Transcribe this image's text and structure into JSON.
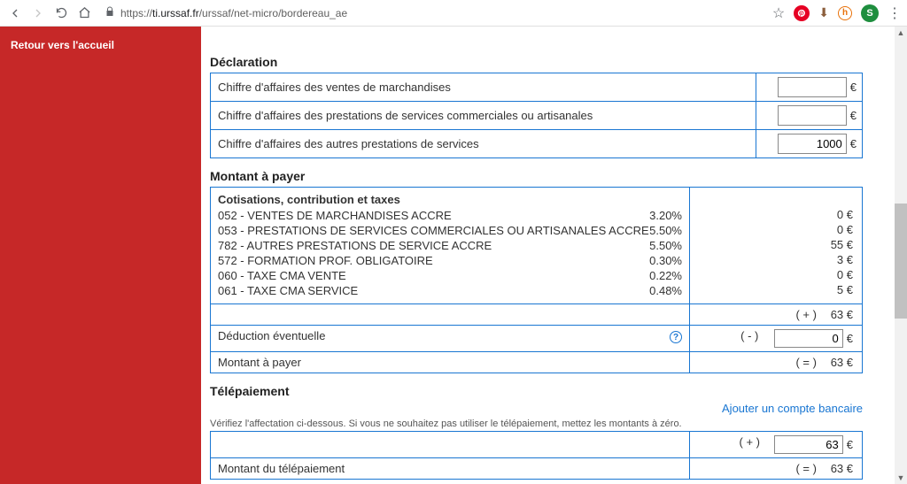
{
  "browser": {
    "url_prefix": "https://",
    "url_host": "ti.urssaf.fr",
    "url_path": "/urssaf/net-micro/bordereau_ae",
    "avatar_letter": "S"
  },
  "sidebar": {
    "home_link": "Retour vers l'accueil"
  },
  "declaration": {
    "title": "Déclaration",
    "rows": [
      {
        "label": "Chiffre d'affaires des ventes de marchandises",
        "value": ""
      },
      {
        "label": "Chiffre d'affaires des prestations de services commerciales ou artisanales",
        "value": ""
      },
      {
        "label": "Chiffre d'affaires des autres prestations de services",
        "value": "1000"
      }
    ],
    "currency": "€"
  },
  "montant": {
    "title": "Montant à payer",
    "subheader": "Cotisations, contribution et taxes",
    "lines": [
      {
        "label": "052 - VENTES DE MARCHANDISES ACCRE",
        "rate": "3.20%",
        "amount": "0 €"
      },
      {
        "label": "053 - PRESTATIONS DE SERVICES COMMERCIALES OU ARTISANALES ACCRE",
        "rate": "5.50%",
        "amount": "0 €"
      },
      {
        "label": "782 - AUTRES PRESTATIONS DE SERVICE ACCRE",
        "rate": "5.50%",
        "amount": "55 €"
      },
      {
        "label": "572 - FORMATION PROF. OBLIGATOIRE",
        "rate": "0.30%",
        "amount": "3 €"
      },
      {
        "label": "060 - TAXE CMA VENTE",
        "rate": "0.22%",
        "amount": "0 €"
      },
      {
        "label": "061 - TAXE CMA SERVICE",
        "rate": "0.48%",
        "amount": "5 €"
      }
    ],
    "subtotal_op": "( + )",
    "subtotal": "63 €",
    "deduction_label": "Déduction éventuelle",
    "deduction_op": "( - )",
    "deduction_value": "0",
    "total_label": "Montant à payer",
    "total_op": "( = )",
    "total": "63 €",
    "currency": "€"
  },
  "tele": {
    "title": "Télépaiement",
    "add_account": "Ajouter un compte bancaire",
    "hint": "Vérifiez l'affectation ci-dessous. Si vous ne souhaitez pas utiliser le télépaiement, mettez les montants à zéro.",
    "row_op": "( + )",
    "row_value": "63",
    "total_label": "Montant du télépaiement",
    "total_op": "( = )",
    "total": "63 €",
    "currency": "€"
  }
}
